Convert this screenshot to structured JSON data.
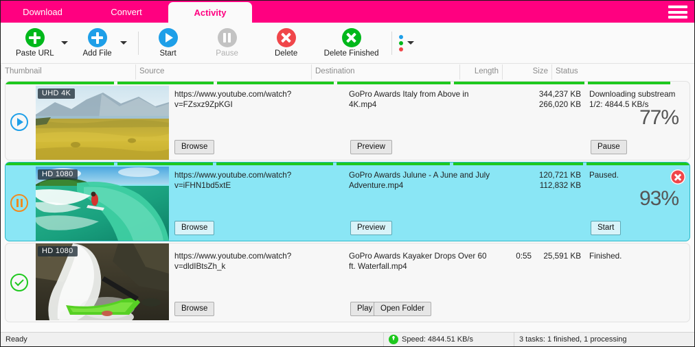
{
  "window": {
    "tabs": [
      {
        "label": "Download",
        "active": false
      },
      {
        "label": "Convert",
        "active": false
      },
      {
        "label": "Activity",
        "active": true
      }
    ],
    "menu_icon": "hamburger-icon",
    "accent_color": "#ff0080"
  },
  "toolbar": {
    "items": [
      {
        "label": "Paste URL",
        "icon": "plus-circle-green-icon",
        "has_caret": true,
        "disabled": false
      },
      {
        "label": "Add File",
        "icon": "plus-circle-blue-icon",
        "has_caret": true,
        "disabled": false
      },
      {
        "label": "Start",
        "icon": "play-circle-blue-icon",
        "has_caret": false,
        "disabled": false
      },
      {
        "label": "Pause",
        "icon": "pause-circle-grey-icon",
        "has_caret": false,
        "disabled": true
      },
      {
        "label": "Delete",
        "icon": "x-circle-red-icon",
        "has_caret": false,
        "disabled": false
      },
      {
        "label": "Delete Finished",
        "icon": "x-circle-green-icon",
        "has_caret": false,
        "disabled": false
      }
    ],
    "more_menu": {
      "icon": "three-dots-icon",
      "has_caret": true
    }
  },
  "columns": {
    "thumbnail": "Thumbnail",
    "source": "Source",
    "destination": "Destination",
    "length": "Length",
    "size": "Size",
    "status": "Status"
  },
  "rows": [
    {
      "state_icon": "play-ring-icon",
      "state_color": "#1e9fe8",
      "quality_badge": "UHD 4K",
      "source_url": "https://www.youtube.com/watch?v=FZsxz9ZpKGI",
      "destination": "GoPro Awards  Italy from Above in 4K.mp4",
      "length": "",
      "size_total": "344,237 KB",
      "size_done": "266,020 KB",
      "status": "Downloading substream 1/2: 4844.5 KB/s",
      "percent": "77%",
      "progress_value": 77,
      "selected": false,
      "buttons": {
        "source": "Browse",
        "destination": "Preview",
        "status": "Pause"
      },
      "has_close": false
    },
    {
      "state_icon": "pause-ring-icon",
      "state_color": "#f08a1e",
      "quality_badge": "HD 1080",
      "source_url": "https://www.youtube.com/watch?v=iFHN1bd5xtE",
      "destination": "GoPro Awards  Julune - A June and July Adventure.mp4",
      "length": "",
      "size_total": "120,721 KB",
      "size_done": "112,832 KB",
      "status": "Paused.",
      "percent": "93%",
      "progress_value": 93,
      "selected": true,
      "buttons": {
        "source": "Browse",
        "destination": "Preview",
        "status": "Start"
      },
      "has_close": true,
      "close_icon": "close-circle-red-icon"
    },
    {
      "state_icon": "check-ring-icon",
      "state_color": "#1ec81e",
      "quality_badge": "HD 1080",
      "source_url": "https://www.youtube.com/watch?v=dldIBtsZh_k",
      "destination": "GoPro Awards  Kayaker Drops Over 60 ft. Waterfall.mp4",
      "length": "0:55",
      "size_total": "25,591 KB",
      "size_done": "",
      "status": "Finished.",
      "percent": "",
      "progress_value": 100,
      "selected": false,
      "buttons": {
        "source": "Browse",
        "destination": "Play",
        "destination2": "Open Folder",
        "status": ""
      },
      "has_close": false
    }
  ],
  "statusbar": {
    "ready": "Ready",
    "speed_icon": "download-arrow-icon",
    "speed": "Speed: 4844.51 KB/s",
    "tasks": "3 tasks: 1 finished, 1 processing"
  }
}
